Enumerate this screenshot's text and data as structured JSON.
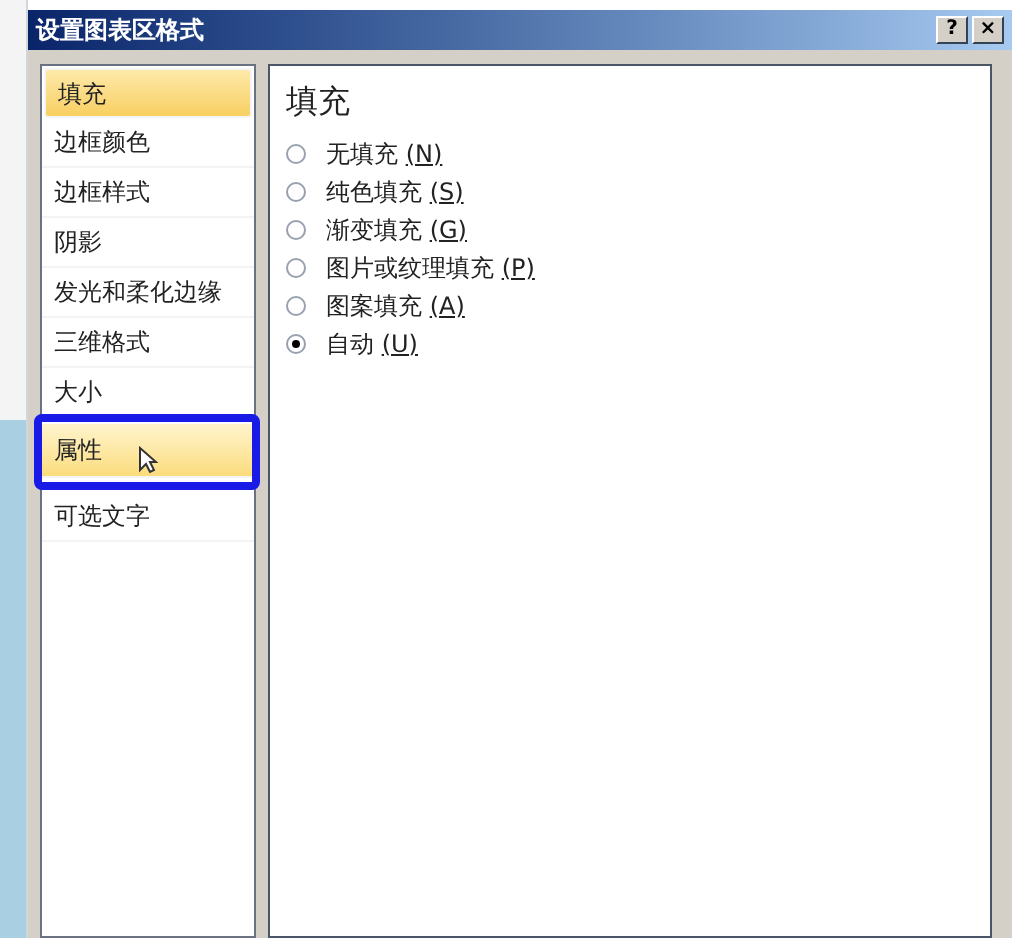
{
  "window": {
    "title": "设置图表区格式",
    "buttons": [
      "?",
      "×"
    ]
  },
  "sidebar": {
    "items": [
      {
        "label": "填充",
        "selected": true,
        "hovered": false
      },
      {
        "label": "边框颜色",
        "selected": false,
        "hovered": false
      },
      {
        "label": "边框样式",
        "selected": false,
        "hovered": false
      },
      {
        "label": "阴影",
        "selected": false,
        "hovered": false
      },
      {
        "label": "发光和柔化边缘",
        "selected": false,
        "hovered": false
      },
      {
        "label": "三维格式",
        "selected": false,
        "hovered": false
      },
      {
        "label": "大小",
        "selected": false,
        "hovered": false
      },
      {
        "label": "属性",
        "selected": false,
        "hovered": true
      },
      {
        "label": "可选文字",
        "selected": false,
        "hovered": false
      }
    ]
  },
  "panel": {
    "heading": "填充",
    "options": [
      {
        "label": "无填充",
        "key": "(N)",
        "selected": false
      },
      {
        "label": "纯色填充",
        "key": "(S)",
        "selected": false
      },
      {
        "label": "渐变填充",
        "key": "(G)",
        "selected": false
      },
      {
        "label": "图片或纹理填充",
        "key": "(P)",
        "selected": false
      },
      {
        "label": "图案填充",
        "key": "(A)",
        "selected": false
      },
      {
        "label": "自动",
        "key": "(U)",
        "selected": true
      }
    ]
  }
}
